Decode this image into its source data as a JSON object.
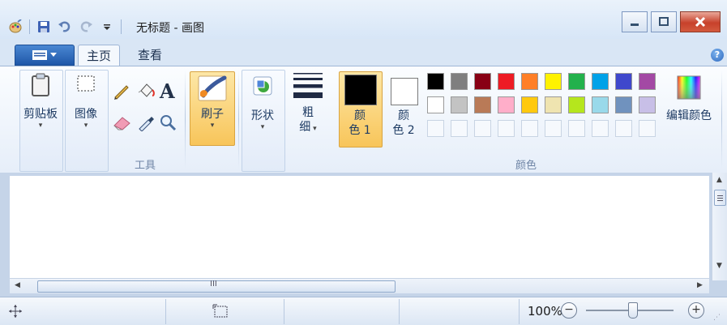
{
  "window": {
    "title": "无标题 - 画图"
  },
  "tabs": {
    "home": "主页",
    "view": "查看"
  },
  "help": {
    "label": "?"
  },
  "ribbon": {
    "clipboard": {
      "label": "剪贴板"
    },
    "image": {
      "label": "图像"
    },
    "tools": {
      "group_label": "工具",
      "text_tool": "A"
    },
    "brushes": {
      "label": "刷子"
    },
    "shapes": {
      "label": "形状"
    },
    "size": {
      "line1": "粗",
      "line2": "细"
    },
    "color1": {
      "line1": "颜",
      "line2": "色 1"
    },
    "color2": {
      "line1": "颜",
      "line2": "色 2"
    },
    "colors": {
      "group_label": "颜色",
      "edit_label": "编辑颜色",
      "row1": [
        "#000000",
        "#7f7f7f",
        "#880015",
        "#ed1c24",
        "#ff7f27",
        "#fff200",
        "#22b14c",
        "#00a2e8",
        "#3f48cc",
        "#a349a4"
      ],
      "row2": [
        "#ffffff",
        "#c3c3c3",
        "#b97a57",
        "#ffaec9",
        "#ffc90e",
        "#efe4b0",
        "#b5e61d",
        "#99d9ea",
        "#7092be",
        "#c8bfe7"
      ],
      "active_color1": "#000000",
      "active_color2": "#ffffff"
    }
  },
  "scrollbars": {
    "h_thumb_grip": "III"
  },
  "status": {
    "zoom": "100%",
    "zoom_out": "−",
    "zoom_in": "+"
  }
}
